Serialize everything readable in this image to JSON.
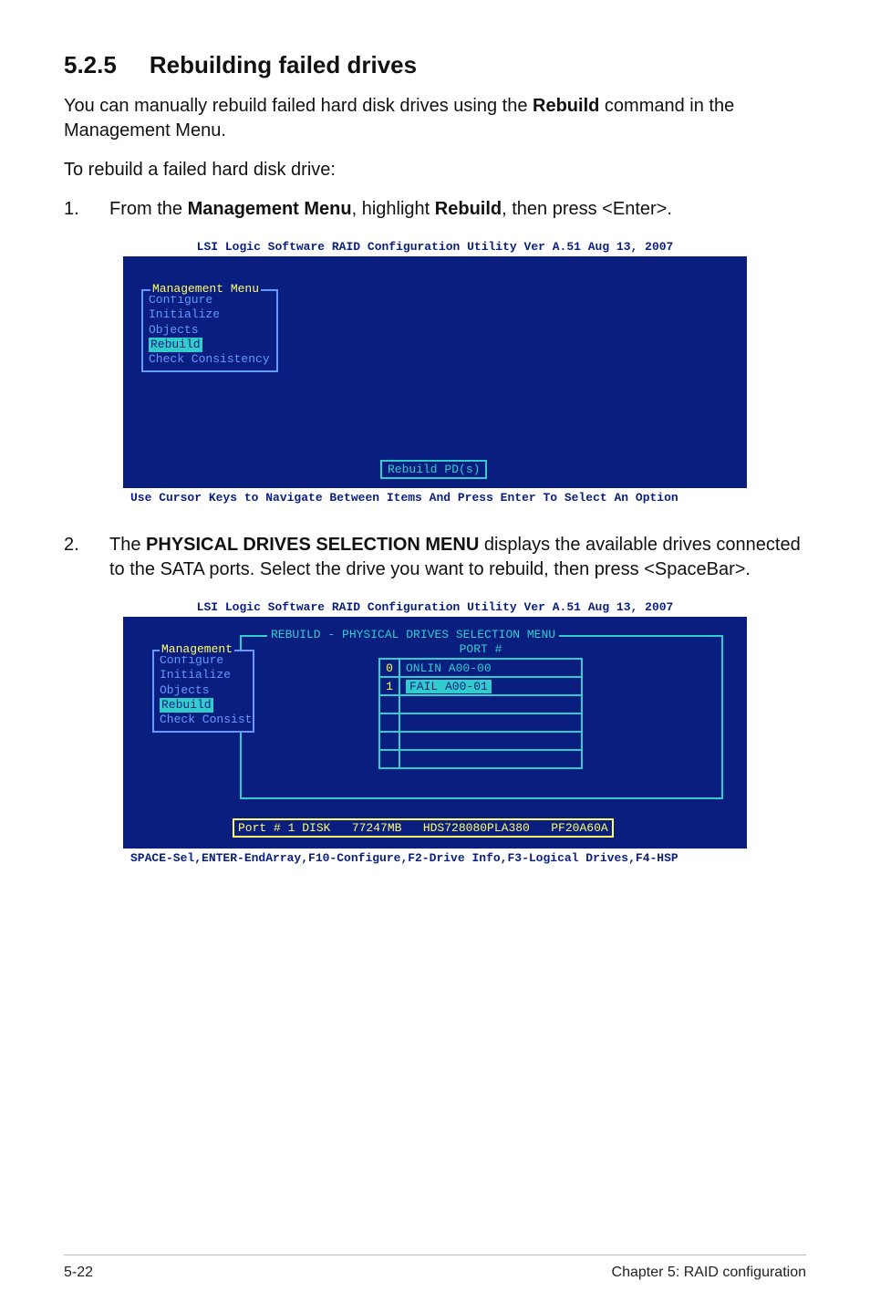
{
  "heading": {
    "number": "5.2.5",
    "title": "Rebuilding failed drives"
  },
  "intro": {
    "p1_a": "You can manually rebuild failed hard disk drives using the ",
    "p1_b": "Rebuild",
    "p1_c": " command in the Management Menu.",
    "p2": "To rebuild a failed hard disk drive:"
  },
  "steps": {
    "s1": {
      "num": "1.",
      "t_a": "From the ",
      "t_b": "Management Menu",
      "t_c": ", highlight ",
      "t_d": "Rebuild",
      "t_e": ", then press <Enter>."
    },
    "s2": {
      "num": "2.",
      "t_a": "The ",
      "t_b": "PHYSICAL DRIVES SELECTION MENU",
      "t_c": " displays the available drives connected to the SATA ports. Select the drive you want to rebuild, then press <SpaceBar>."
    }
  },
  "console1": {
    "title": "LSI Logic Software RAID Configuration Utility Ver A.51 Aug 13, 2007",
    "menu_title": "Management Menu",
    "items": {
      "configure": "Configure",
      "initialize": "Initialize",
      "objects": "Objects",
      "rebuild": "Rebuild",
      "check": "Check Consistency"
    },
    "action": "Rebuild PD(s)",
    "footer": "Use Cursor Keys to Navigate Between Items And Press Enter To Select An Option"
  },
  "console2": {
    "title": "LSI Logic Software RAID Configuration Utility Ver A.51 Aug 13, 2007",
    "panel_title": "REBUILD - PHYSICAL DRIVES SELECTION MENU",
    "menu_title": "Management",
    "items": {
      "configure": "Configure",
      "initialize": "Initialize",
      "objects": "Objects",
      "rebuild": "Rebuild",
      "check": "Check Consist"
    },
    "port_header": "PORT #",
    "rows": {
      "r0": {
        "n": "0",
        "v": "ONLIN A00-00"
      },
      "r1": {
        "n": "1",
        "v": "FAIL  A00-01"
      }
    },
    "status": "Port # 1 DISK   77247MB   HDS728080PLA380   PF20A60A",
    "footer": "SPACE-Sel,ENTER-EndArray,F10-Configure,F2-Drive Info,F3-Logical Drives,F4-HSP"
  },
  "footer": {
    "left": "5-22",
    "right": "Chapter 5: RAID configuration"
  }
}
